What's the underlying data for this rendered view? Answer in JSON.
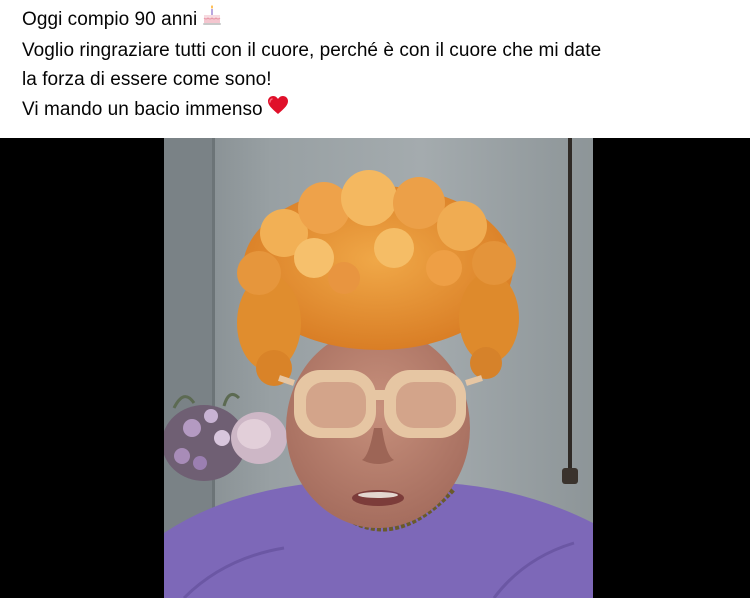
{
  "post": {
    "lines": [
      "Oggi compio 90 anni",
      "Voglio ringraziare tutti con il cuore, perché è con il cuore che mi date",
      "la forza di essere come sono!",
      "Vi mando un bacio immenso"
    ],
    "emojis": {
      "line1": "birthday-cake-icon",
      "line4": "red-heart-icon"
    }
  },
  "video": {
    "background": "#000000",
    "accent_colors": {
      "hair": "#e8962e",
      "sweater": "#7d68b8",
      "glasses": "#e9c9a6",
      "heart": "#e0102a"
    }
  }
}
